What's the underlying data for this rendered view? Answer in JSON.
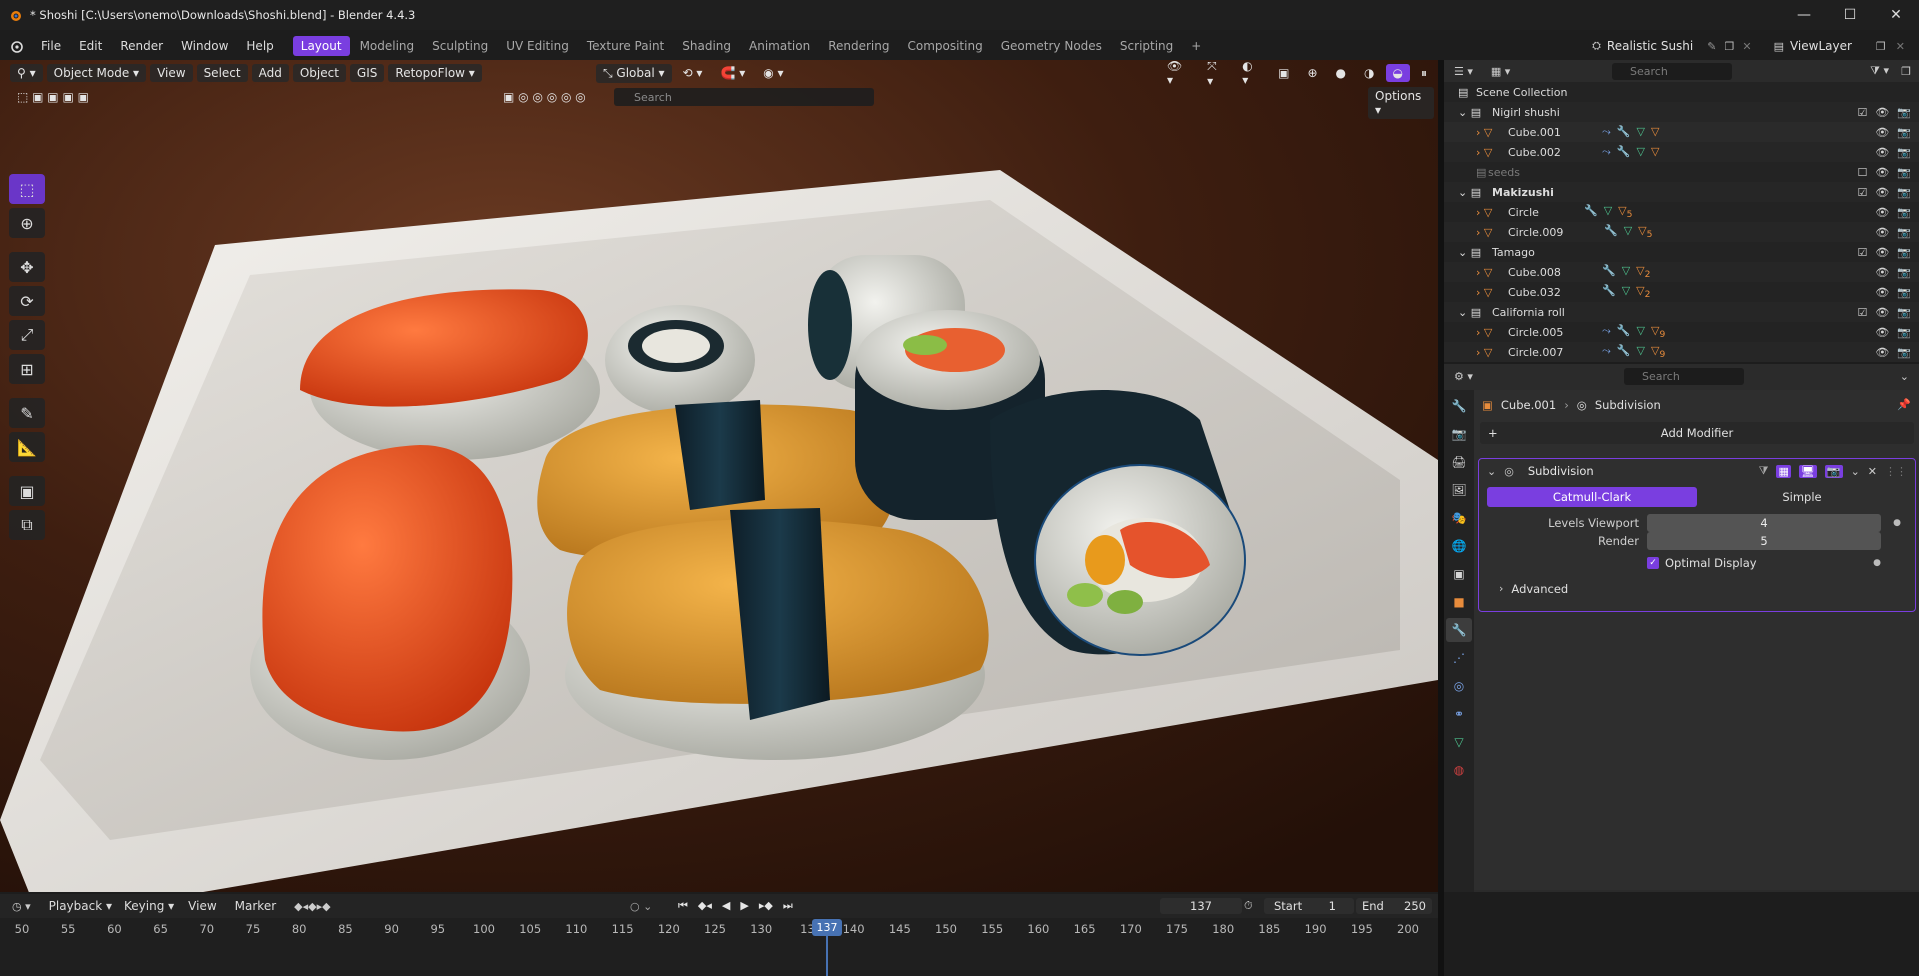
{
  "window": {
    "title": "* Shoshi [C:\\Users\\onemo\\Downloads\\Shoshi.blend] - Blender 4.4.3",
    "minimize": "—",
    "maximize": "☐",
    "close": "✕"
  },
  "menu": {
    "items": [
      "File",
      "Edit",
      "Render",
      "Window",
      "Help"
    ],
    "workspaces": [
      "Layout",
      "Modeling",
      "Sculpting",
      "UV Editing",
      "Texture Paint",
      "Shading",
      "Animation",
      "Rendering",
      "Compositing",
      "Geometry Nodes",
      "Scripting"
    ],
    "add_workspace": "+",
    "scene_name": "Realistic Sushi",
    "view_layer": "ViewLayer"
  },
  "viewport": {
    "mode": "Object Mode",
    "menus": [
      "View",
      "Select",
      "Add",
      "Object",
      "GIS"
    ],
    "addon": "RetopoFlow",
    "transform_orientation": "Global",
    "search_placeholder": "Search",
    "options": "Options"
  },
  "outliner": {
    "search_placeholder": "Search",
    "scene_collection": "Scene Collection",
    "rows": [
      {
        "label": "Nigirl shushi",
        "type": "collection"
      },
      {
        "label": "Cube.001",
        "type": "object"
      },
      {
        "label": "Cube.002",
        "type": "object"
      },
      {
        "label": "seeds",
        "type": "collection-excluded"
      },
      {
        "label": "Makizushi",
        "type": "collection"
      },
      {
        "label": "Circle",
        "type": "object",
        "badge": "5"
      },
      {
        "label": "Circle.009",
        "type": "object",
        "badge": "5"
      },
      {
        "label": "Tamago",
        "type": "collection"
      },
      {
        "label": "Cube.008",
        "type": "object",
        "badge": "2"
      },
      {
        "label": "Cube.032",
        "type": "object",
        "badge": "2"
      },
      {
        "label": "California roll",
        "type": "collection"
      },
      {
        "label": "Circle.005",
        "type": "object",
        "badge": "9"
      },
      {
        "label": "Circle.007",
        "type": "object",
        "badge": "9"
      }
    ]
  },
  "properties": {
    "search_placeholder": "Search",
    "object_name": "Cube.001",
    "modifier_crumb": "Subdivision",
    "add_modifier": "Add Modifier",
    "modifier": {
      "name": "Subdivision",
      "method_a": "Catmull-Clark",
      "method_b": "Simple",
      "levels_viewport_label": "Levels Viewport",
      "levels_viewport": "4",
      "render_label": "Render",
      "render": "5",
      "optimal_display": "Optimal Display",
      "advanced": "Advanced"
    }
  },
  "timeline": {
    "menus": [
      "Playback",
      "Keying",
      "View",
      "Marker"
    ],
    "current_frame": "137",
    "start_label": "Start",
    "start": "1",
    "end_label": "End",
    "end": "250",
    "ruler": [
      "50",
      "55",
      "60",
      "65",
      "70",
      "75",
      "80",
      "85",
      "90",
      "95",
      "100",
      "105",
      "110",
      "115",
      "120",
      "125",
      "130",
      "13",
      "140",
      "145",
      "150",
      "155",
      "160",
      "165",
      "170",
      "175",
      "180",
      "185",
      "190",
      "195",
      "200"
    ],
    "playhead": "137"
  }
}
